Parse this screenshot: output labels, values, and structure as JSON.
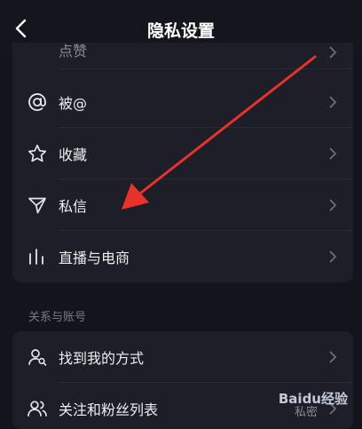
{
  "header": {
    "title": "隐私设置"
  },
  "list_top": {
    "partial_label": "点赞",
    "items": [
      {
        "label": "被@"
      },
      {
        "label": "收藏"
      },
      {
        "label": "私信"
      },
      {
        "label": "直播与电商"
      }
    ]
  },
  "section": {
    "title": "关系与账号"
  },
  "list_bottom": {
    "items": [
      {
        "label": "找到我的方式"
      },
      {
        "label": "关注和粉丝列表",
        "value": "私密"
      }
    ]
  },
  "watermark": {
    "text": "Baidu经验"
  },
  "colors": {
    "background": "#14141c",
    "card": "#1e1e28",
    "annotation_arrow": "#e8322c"
  }
}
